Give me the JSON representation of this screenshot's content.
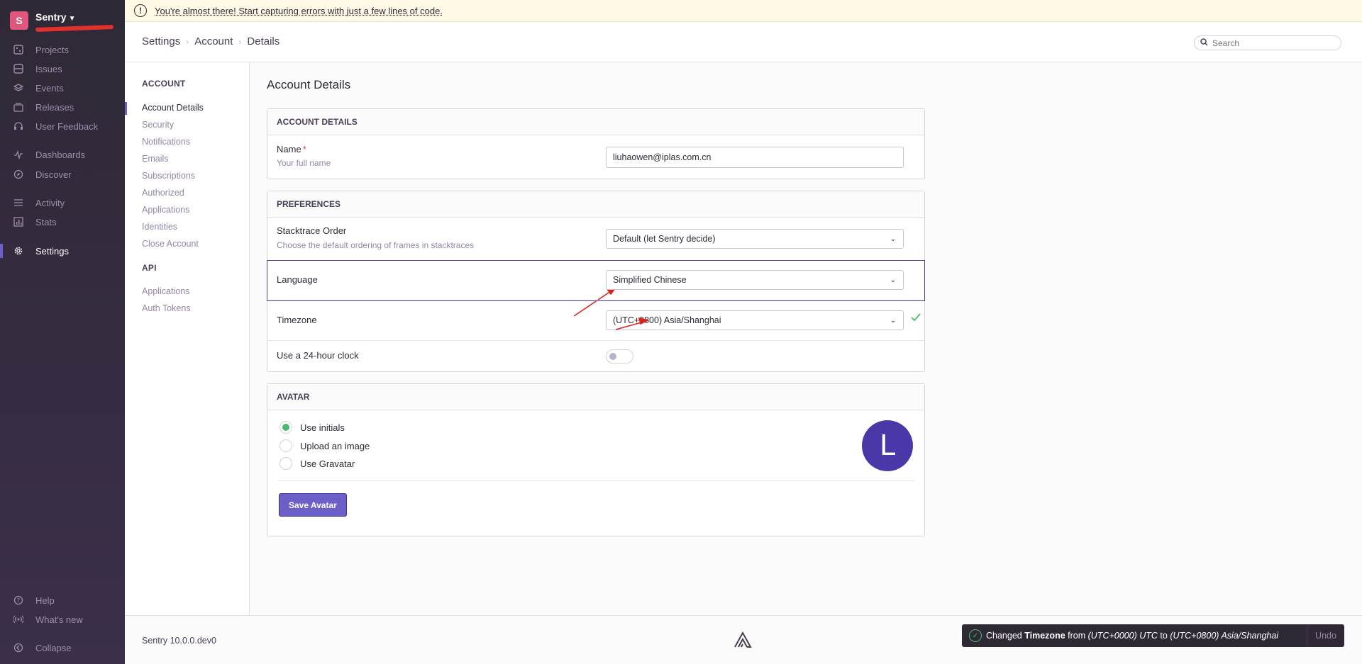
{
  "banner": {
    "text": "You're almost there! Start capturing errors with just a few lines of code."
  },
  "org": {
    "initial": "S",
    "name": "Sentry"
  },
  "sidebar": {
    "items": [
      {
        "label": "Projects",
        "icon": "projects-icon"
      },
      {
        "label": "Issues",
        "icon": "issues-icon"
      },
      {
        "label": "Events",
        "icon": "events-icon"
      },
      {
        "label": "Releases",
        "icon": "releases-icon"
      },
      {
        "label": "User Feedback",
        "icon": "user-feedback-icon"
      },
      {
        "label": "Dashboards",
        "icon": "dashboards-icon"
      },
      {
        "label": "Discover",
        "icon": "discover-icon"
      },
      {
        "label": "Activity",
        "icon": "activity-icon"
      },
      {
        "label": "Stats",
        "icon": "stats-icon"
      },
      {
        "label": "Settings",
        "icon": "gear-icon"
      }
    ],
    "bottom": [
      {
        "label": "Help",
        "icon": "help-icon"
      },
      {
        "label": "What's new",
        "icon": "broadcast-icon"
      },
      {
        "label": "Collapse",
        "icon": "collapse-icon"
      }
    ]
  },
  "header": {
    "breadcrumbs": [
      "Settings",
      "Account",
      "Details"
    ],
    "search_placeholder": "Search"
  },
  "subnav": {
    "account_title": "ACCOUNT",
    "account_links": [
      "Account Details",
      "Security",
      "Notifications",
      "Emails",
      "Subscriptions",
      "Authorized",
      "Applications",
      "Identities",
      "Close Account"
    ],
    "api_title": "API",
    "api_links": [
      "Applications",
      "Auth Tokens"
    ]
  },
  "page": {
    "title": "Account Details"
  },
  "account_panel": {
    "title": "ACCOUNT DETAILS",
    "name_label": "Name",
    "name_required": "*",
    "name_help": "Your full name",
    "name_value": "liuhaowen@iplas.com.cn"
  },
  "preferences": {
    "title": "PREFERENCES",
    "stacktrace_label": "Stacktrace Order",
    "stacktrace_help": "Choose the default ordering of frames in stacktraces",
    "stacktrace_value": "Default (let Sentry decide)",
    "language_label": "Language",
    "language_value": "Simplified Chinese",
    "timezone_label": "Timezone",
    "timezone_value": "(UTC+0800) Asia/Shanghai",
    "clock_label": "Use a 24-hour clock",
    "clock_on": false
  },
  "avatar": {
    "title": "AVATAR",
    "options": [
      "Use initials",
      "Upload an image",
      "Use Gravatar"
    ],
    "selected": "Use initials",
    "initial": "L",
    "save_label": "Save Avatar"
  },
  "footer": {
    "version": "Sentry 10.0.0.dev0"
  },
  "toast": {
    "prefix": "Changed",
    "field": "Timezone",
    "from_word": "from",
    "old_value": "(UTC+0000) UTC",
    "to_word": "to",
    "new_value": "(UTC+0800) Asia/Shanghai",
    "undo": "Undo"
  },
  "colors": {
    "accent": "#6c5fc7",
    "success": "#4ab96f",
    "sidebar": "#2f2936",
    "avatar": "#4a38a8",
    "annotation": "#e0201a"
  }
}
